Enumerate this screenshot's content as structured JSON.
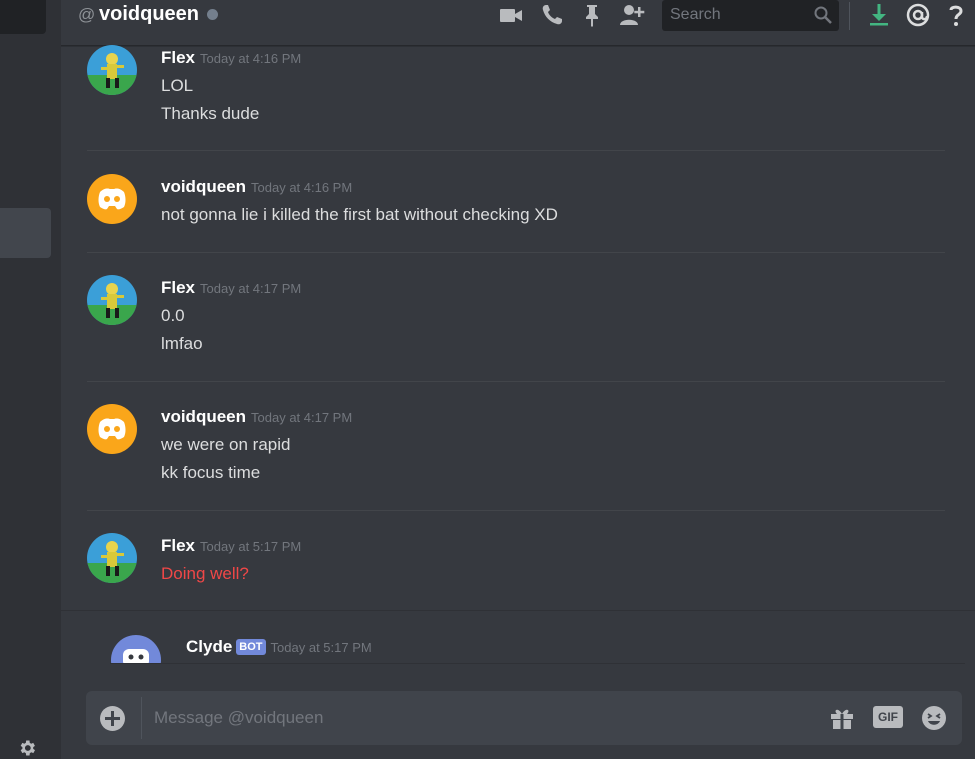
{
  "header": {
    "at_symbol": "@",
    "title": "voidqueen",
    "search_placeholder": "Search",
    "icons": [
      "video-call-icon",
      "voice-call-icon",
      "pin-icon",
      "add-friend-icon",
      "search-icon",
      "download-icon",
      "mention-icon",
      "help-icon"
    ]
  },
  "messages": [
    {
      "author": "Flex",
      "timestamp": "Today at 4:16 PM",
      "lines": [
        "LOL",
        "Thanks dude"
      ]
    },
    {
      "author": "voidqueen",
      "timestamp": "Today at 4:16 PM",
      "lines": [
        "not gonna lie i killed the first bat without checking XD"
      ]
    },
    {
      "author": "Flex",
      "timestamp": "Today at 4:17 PM",
      "lines": [
        "0.0",
        "lmfao"
      ]
    },
    {
      "author": "voidqueen",
      "timestamp": "Today at 4:17 PM",
      "lines": [
        "we were on rapid",
        "kk focus time"
      ]
    },
    {
      "author": "Flex",
      "timestamp": "Today at 5:17 PM",
      "lines": [
        "Doing well?"
      ],
      "failed": true
    },
    {
      "author": "Clyde",
      "tag": "BOT",
      "timestamp": "Today at 5:17 PM",
      "lines": []
    }
  ],
  "composer": {
    "placeholder": "Message @voidqueen",
    "gif_label": "GIF"
  },
  "colors": {
    "background": "#36393f",
    "sidebar": "#2f3136",
    "accent_bot": "#7289da",
    "error_text": "#f04747",
    "discord_orange": "#faa61a",
    "status_offline": "#747f8d",
    "download_green": "#43b581"
  }
}
